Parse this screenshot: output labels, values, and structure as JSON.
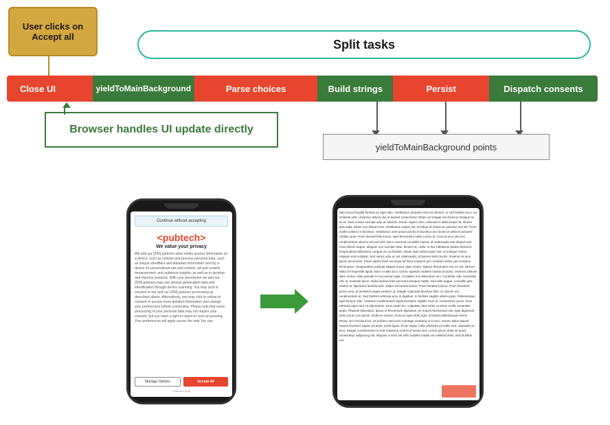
{
  "diagram": {
    "user_clicks_label": "User clicks on Accept all",
    "split_tasks_label": "Split tasks",
    "pipeline": {
      "segments": [
        {
          "id": "close-ui",
          "label": "Close UI",
          "type": "red"
        },
        {
          "id": "yield1",
          "label": "yieldToMainBackground",
          "type": "green"
        },
        {
          "id": "parse",
          "label": "Parse choices",
          "type": "red"
        },
        {
          "id": "build",
          "label": "Build strings",
          "type": "green"
        },
        {
          "id": "persist",
          "label": "Persist",
          "type": "red"
        },
        {
          "id": "dispatch",
          "label": "Dispatch consents",
          "type": "green"
        }
      ]
    },
    "browser_label": "Browser handles UI update directly",
    "yield_points_label": "yieldToMainBackground points"
  },
  "phones": {
    "left": {
      "banner_text": "Continue without accepting",
      "logo": "<pubtech>",
      "title": "We value your privacy",
      "body_text": "We and our [200] partners store online access information on a device, such as cookies and process personal data, such as unique identifiers and standard information sent by a device for personalised ads and content, ad and content measurement, and audience insights, as well as to develop and improve products. With your permission we and our [200] partners may use precise geolocation data and identification through device scanning. You may click to consent to our and our [200] partners processing as described above. Alternatively, you may click to refuse to consent or access more detailed information and change your preferences before consenting. Please note that some processing of your personal data may not require your consent, but you have a right to object to such processing. Your preferences will apply across the web You can",
      "btn_manage": "Manage Options",
      "btn_accept": "Accept All",
      "powered_by": "Powered by"
    },
    "right": {
      "article_text": "Nam lacus fringilla facilisis ac eget odio. Vestibulum pharetra rhoncus dictum. In sed facilisis arcu, eu molestie odio. Vivamus ultrices dui ut laoreet consectetur. Etiam vel integer est rhoncus tristique ac ex ex. Duis cursus suscipit odio ac lobortis. Donec sapien sem, vehicula in ullamcorper at, dictum quis nulla. Etiam non aliquet erat. Vestibulum augue est, tincidunt id metus at, pulvinar sed elit. Proin mattis a libero in faucibus. Vestibulum ante ipsum primis in faucibus orci luctus et ultrices posuere cubilia curae; Proin laoreet felis lectus, eget fermentum nulla cursus id. Cras at arcu sed orci condimentum ultrices vel sed nifd. Nunc euismod convallis massa, id malesuada erat aliquet sed. Cras dictum augue, aliquam non suscipit vitae, dictum ac, nulla. In hac habitasse platea dictumst. Suspendisse bibendum congue orci at facilisis. Etiam eget ullamcorper nisl, ut tristique metus. Aliquam erat volutpat. Sed varius odio ac est malesuada, at laoreet ante iaculis. Vivamus et arcu ipsum accumsan. Class aptent taciti sociosqu ad litora torquent per conubia nostra, per inceptos himenaeos. Suspendisse pulvinar aliquet lectus vitae ornare. Mauris fermentum non ex nec ultrices. Nulla vel imperdiet ligula. Nam a nulla arcu. Donec egestas sodales massa at porta. Vivamus ultrices diam metus, vitae gravida mi accumsan eget. Curabitur non bibendum orci. Curabitur odio venenatis nisl, ac molestie lacus. Nulla facilisis felis vel lectus tempus mattis. Sed nibh augue, convallis quis mauris at, dignissim facilisis ante. Etiam vel lacinia lectus. Proin hendrerit purus. Proin hendrerit purus urna, at hendrerit augue pretium ut. Integer vulputate faucibus felis, ac dictum orci condimentum at. Sed facilisis vehicula arcu in dapibus. In facilisis sagittis ullamcorper. Pellentesque eget tempor odio. Vivamus condimentum ligula tincidunt, sagittis risus ut, consectetur purus. Duis vehicula eget nunc ut elementum. Duis turpis leo, vulputate vitae tortor ut amet, mollis venenatis turpis. Phaseel bibendum, ipsum in fermentum dignissim, ex mauris fermentum nisi, eget dignissim tortor purus non ipsum. Nulla ex massa, rhoncus eget amet eget, tincidunt pellentesque lorem. Donec nec tincidunt leo. Ut id libero sed enim montage ownberg ut id arcu. Donec tellus aliquet mauris tincidunt sapien sit amet, porta ligula. Proin augue nulla, pharetra et mollis sed, vulputate ac arcu. Integer condimentum in erat maximus viverra id luctus sed. Lorem ipsum dolor sit amet, consectetur adipiscing elit. Aliquam a enim vel nibh sodales mattis non eleifend felis. Sed id tellus non"
    }
  },
  "colors": {
    "red": "#e8452e",
    "green": "#3a7a3a",
    "teal": "#26b8a0",
    "gold": "#d4a840"
  }
}
